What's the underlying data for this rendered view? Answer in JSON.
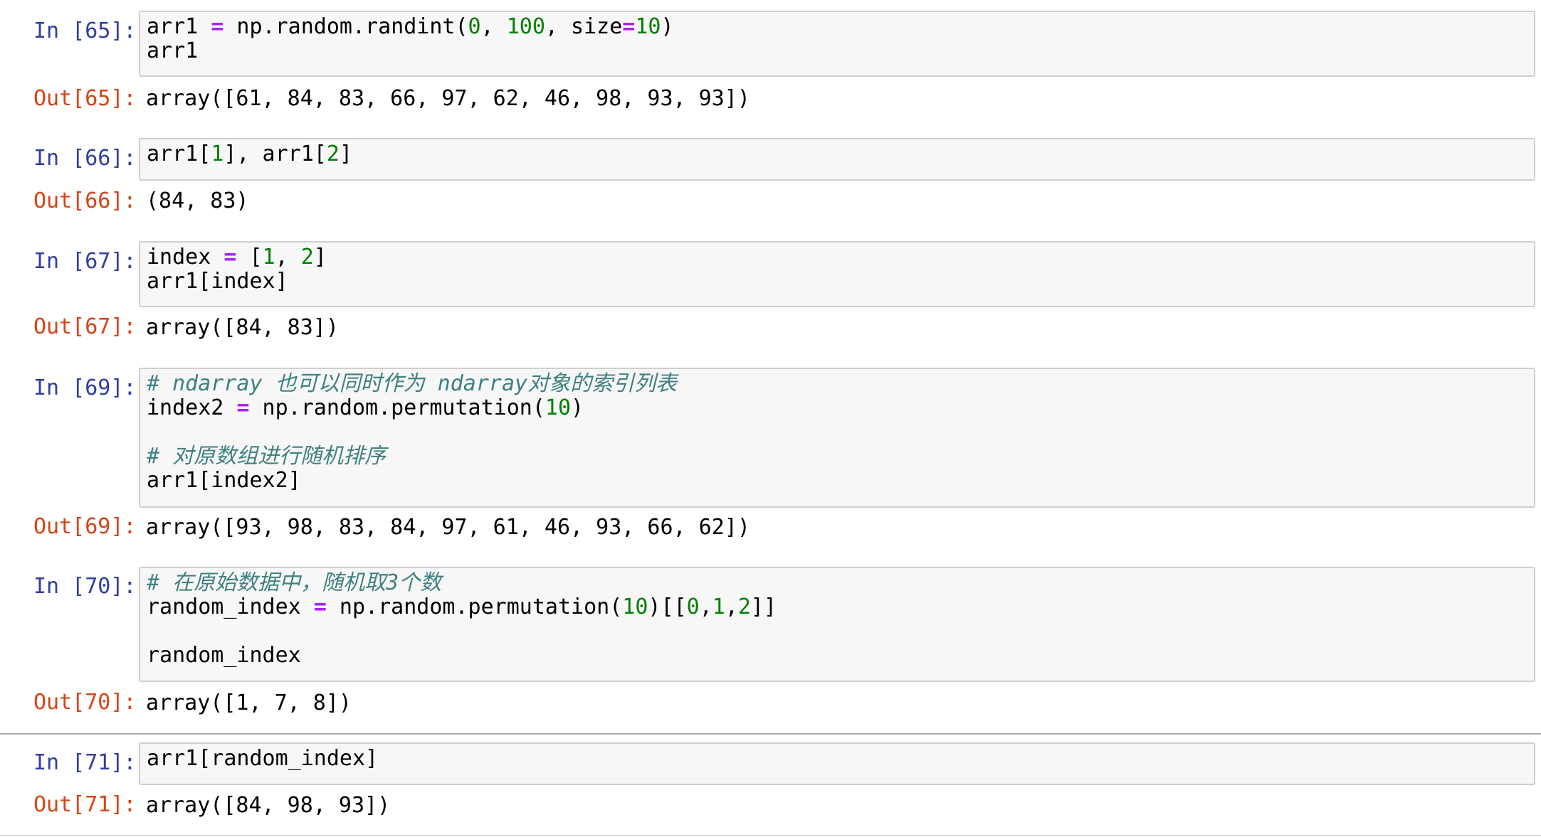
{
  "colors": {
    "in_prompt": "#303f9f",
    "out_prompt": "#d84315",
    "operator": "#aa22ff",
    "number": "#008000",
    "comment": "#408080",
    "input_background": "#f7f7f7",
    "input_border": "#cfcfcf"
  },
  "cells": [
    {
      "in_prompt": "In [65]:",
      "out_prompt": "Out[65]:",
      "code": [
        [
          [
            "plain",
            "arr1 "
          ],
          [
            "op",
            "="
          ],
          [
            "plain",
            " np.random.randint("
          ],
          [
            "num",
            "0"
          ],
          [
            "plain",
            ", "
          ],
          [
            "num",
            "100"
          ],
          [
            "plain",
            ", size"
          ],
          [
            "op",
            "="
          ],
          [
            "num",
            "10"
          ],
          [
            "plain",
            ")"
          ]
        ],
        [
          [
            "plain",
            "arr1"
          ]
        ]
      ],
      "output": "array([61, 84, 83, 66, 97, 62, 46, 98, 93, 93])"
    },
    {
      "in_prompt": "In [66]:",
      "out_prompt": "Out[66]:",
      "code": [
        [
          [
            "plain",
            "arr1["
          ],
          [
            "num",
            "1"
          ],
          [
            "plain",
            "], arr1["
          ],
          [
            "num",
            "2"
          ],
          [
            "plain",
            "]"
          ]
        ]
      ],
      "output": "(84, 83)"
    },
    {
      "in_prompt": "In [67]:",
      "out_prompt": "Out[67]:",
      "code": [
        [
          [
            "plain",
            "index "
          ],
          [
            "op",
            "="
          ],
          [
            "plain",
            " ["
          ],
          [
            "num",
            "1"
          ],
          [
            "plain",
            ", "
          ],
          [
            "num",
            "2"
          ],
          [
            "plain",
            "]"
          ]
        ],
        [
          [
            "plain",
            "arr1[index]"
          ]
        ]
      ],
      "output": "array([84, 83])"
    },
    {
      "in_prompt": "In [69]:",
      "out_prompt": "Out[69]:",
      "code": [
        [
          [
            "comment",
            "# ndarray 也可以同时作为 ndarray对象的索引列表"
          ]
        ],
        [
          [
            "plain",
            "index2 "
          ],
          [
            "op",
            "="
          ],
          [
            "plain",
            " np.random.permutation("
          ],
          [
            "num",
            "10"
          ],
          [
            "plain",
            ")"
          ]
        ],
        [],
        [
          [
            "comment",
            "# 对原数组进行随机排序"
          ]
        ],
        [
          [
            "plain",
            "arr1[index2]"
          ]
        ]
      ],
      "output": "array([93, 98, 83, 84, 97, 61, 46, 93, 66, 62])"
    },
    {
      "in_prompt": "In [70]:",
      "out_prompt": "Out[70]:",
      "code": [
        [
          [
            "comment",
            "# 在原始数据中，随机取3个数"
          ]
        ],
        [
          [
            "plain",
            "random_index "
          ],
          [
            "op",
            "="
          ],
          [
            "plain",
            " np.random.permutation("
          ],
          [
            "num",
            "10"
          ],
          [
            "plain",
            ")[["
          ],
          [
            "num",
            "0"
          ],
          [
            "plain",
            ","
          ],
          [
            "num",
            "1"
          ],
          [
            "plain",
            ","
          ],
          [
            "num",
            "2"
          ],
          [
            "plain",
            "]]"
          ]
        ],
        [],
        [
          [
            "plain",
            "random_index"
          ]
        ]
      ],
      "output": "array([1, 7, 8])"
    },
    {
      "in_prompt": "In [71]:",
      "out_prompt": "Out[71]:",
      "code": [
        [
          [
            "plain",
            "arr1[random_index]"
          ]
        ]
      ],
      "output": "array([84, 98, 93])"
    }
  ]
}
